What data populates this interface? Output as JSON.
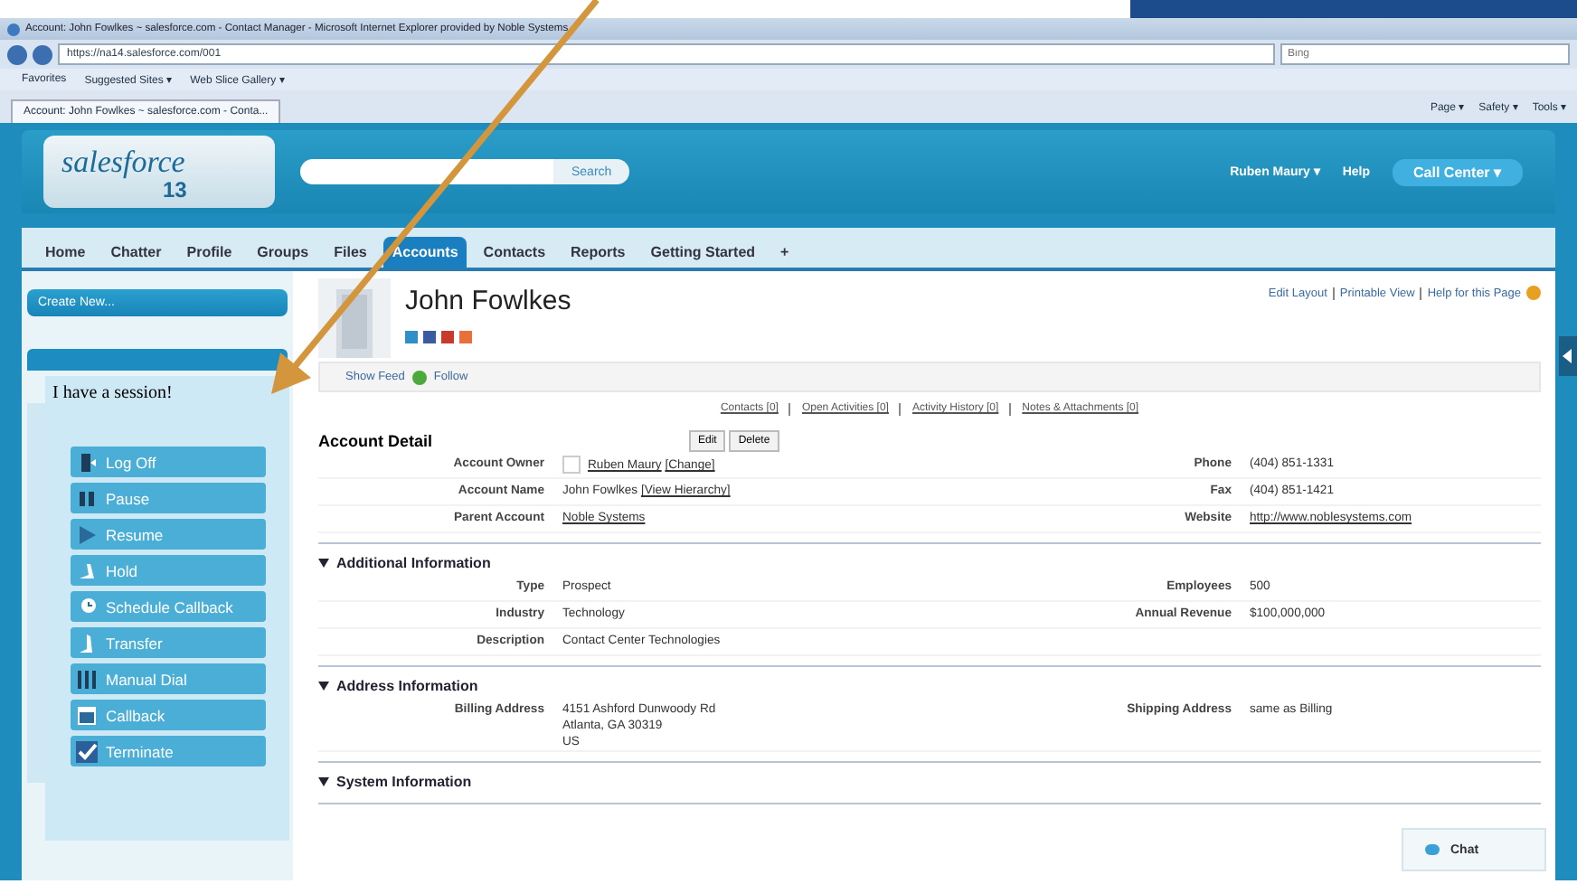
{
  "browser": {
    "title": "Account: John Fowlkes ~ salesforce.com - Contact Manager - Microsoft Internet Explorer provided by Noble Systems",
    "address": "https://na14.salesforce.com/001",
    "search_placeholder": "Bing",
    "favorites": [
      "Favorites",
      "Suggested Sites ▾",
      "Web Slice Gallery ▾"
    ],
    "tab": "Account: John Fowlkes ~ salesforce.com - Conta...",
    "commands": [
      "Page ▾",
      "Safety ▾",
      "Tools ▾"
    ]
  },
  "header": {
    "logo": "salesforce",
    "logo_number": "13",
    "search_button": "Search",
    "user": "Ruben Maury ▾",
    "help": "Help",
    "call_center": "Call Center ▾"
  },
  "tabs": [
    {
      "label": "Home",
      "selected": false
    },
    {
      "label": "Chatter",
      "selected": false
    },
    {
      "label": "Profile",
      "selected": false
    },
    {
      "label": "Groups",
      "selected": false
    },
    {
      "label": "Files",
      "selected": false
    },
    {
      "label": "Accounts",
      "selected": true
    },
    {
      "label": "Contacts",
      "selected": false
    },
    {
      "label": "Reports",
      "selected": false
    },
    {
      "label": "Getting Started",
      "selected": false
    },
    {
      "label": "+",
      "selected": false
    }
  ],
  "sidebar": {
    "create_new": "Create New..."
  },
  "session_panel": {
    "title": "I have a session!",
    "buttons": [
      {
        "label": "Log Off",
        "kind": "logoff"
      },
      {
        "label": "Pause",
        "kind": "pause"
      },
      {
        "label": "Resume",
        "kind": "resume"
      },
      {
        "label": "Hold",
        "kind": "hold"
      },
      {
        "label": "Schedule Callback",
        "kind": "schedule"
      },
      {
        "label": "Transfer",
        "kind": "transfer"
      },
      {
        "label": "Manual Dial",
        "kind": "dial"
      },
      {
        "label": "Callback",
        "kind": "callback"
      },
      {
        "label": "Terminate",
        "kind": "terminate"
      }
    ]
  },
  "account": {
    "name": "John Fowlkes",
    "page_links": [
      "Edit Layout",
      "Printable View",
      "Help for this Page"
    ],
    "show_feed": "Show Feed",
    "follow": "Follow",
    "related_links": [
      "Contacts [0]",
      "Open Activities [0]",
      "Activity History [0]",
      "Notes & Attachments [0]"
    ],
    "detail_title": "Account Detail",
    "buttons": [
      "Edit",
      "Delete"
    ],
    "sections": [
      {
        "rows": [
          [
            {
              "label": "Account Owner",
              "owner_photo": true,
              "value": [
                {
                  "text": "Ruben Maury",
                  "link": true
                },
                {
                  "text": "[Change]",
                  "link": true
                }
              ]
            },
            {
              "label": "Phone",
              "value": [
                {
                  "text": "(404) 851-1331",
                  "link": false
                }
              ]
            }
          ],
          [
            {
              "label": "Account Name",
              "value": [
                {
                  "text": "John Fowlkes",
                  "link": false
                },
                {
                  "text": "[View Hierarchy]",
                  "link": true
                }
              ]
            },
            {
              "label": "Fax",
              "value": [
                {
                  "text": "(404) 851-1421",
                  "link": false
                }
              ]
            }
          ],
          [
            {
              "label": "Parent Account",
              "value": [
                {
                  "text": "Noble Systems",
                  "link": true
                }
              ]
            },
            {
              "label": "Website",
              "value": [
                {
                  "text": "http://www.noblesystems.com",
                  "link": true
                }
              ]
            }
          ]
        ]
      },
      {
        "title": "Additional Information",
        "rows": [
          [
            {
              "label": "Type",
              "value": [
                {
                  "text": "Prospect",
                  "link": false
                }
              ]
            },
            {
              "label": "Employees",
              "value": [
                {
                  "text": "500",
                  "link": false
                }
              ]
            }
          ],
          [
            {
              "label": "Industry",
              "value": [
                {
                  "text": "Technology",
                  "link": false
                }
              ]
            },
            {
              "label": "Annual Revenue",
              "value": [
                {
                  "text": "$100,000,000",
                  "link": false
                }
              ]
            }
          ],
          [
            {
              "label": "Description",
              "value": [
                {
                  "text": "Contact Center Technologies",
                  "link": false
                }
              ]
            }
          ]
        ]
      },
      {
        "title": "Address Information",
        "rows": [
          [
            {
              "label": "Billing Address",
              "value": [
                {
                  "text": "4151 Ashford Dunwoody Rd\nAtlanta, GA 30319\nUS",
                  "link": false
                }
              ]
            },
            {
              "label": "Shipping Address",
              "value": [
                {
                  "text": "same as Billing",
                  "link": false
                }
              ]
            }
          ]
        ]
      },
      {
        "title": "System Information"
      }
    ]
  },
  "chat": {
    "label": "Chat"
  }
}
